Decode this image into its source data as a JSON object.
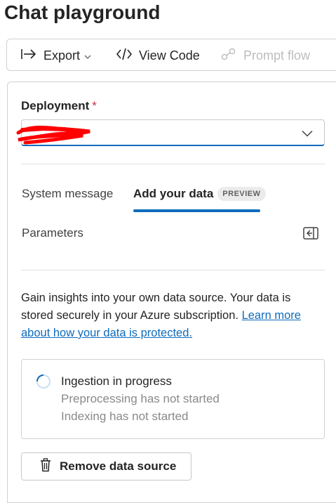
{
  "page": {
    "title": "Chat playground"
  },
  "toolbar": {
    "export_label": "Export",
    "view_code_label": "View Code",
    "prompt_flow_label": "Prompt flow"
  },
  "deployment": {
    "label": "Deployment",
    "required_mark": "*",
    "selected_value": ""
  },
  "tabs": [
    {
      "label": "System message",
      "active": false
    },
    {
      "label": "Add your data",
      "badge": "PREVIEW",
      "active": true
    }
  ],
  "parameters": {
    "label": "Parameters"
  },
  "description": {
    "text": "Gain insights into your own data source. Your data is stored securely in your Azure subscription. ",
    "link": "Learn more about how your data is protected."
  },
  "ingestion": {
    "title": "Ingestion in progress",
    "preprocessing": "Preprocessing has not started",
    "indexing": "Indexing has not started"
  },
  "remove_button": {
    "label": "Remove data source"
  },
  "colors": {
    "accent": "#0f6cbd",
    "required": "#c4314b",
    "muted": "#8a8a8a"
  }
}
